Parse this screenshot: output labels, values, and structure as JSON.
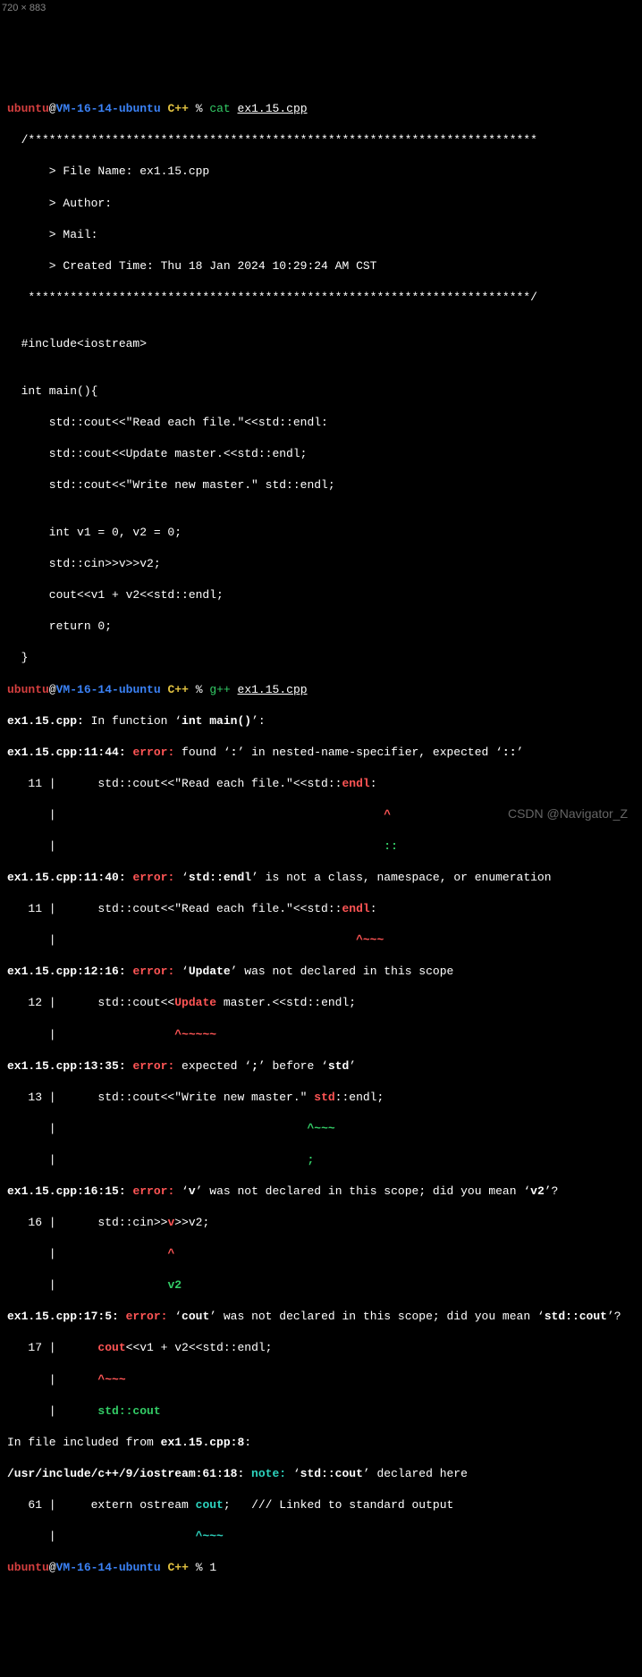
{
  "dim_label": "720 × 883",
  "watermark": "CSDN @Navigator_Z",
  "prompt1": {
    "user": "ubuntu",
    "at": "@",
    "host": "VM-16-14-ubuntu",
    "dir": "C++",
    "pct": "%",
    "cmd": "cat",
    "arg": "ex1.15.cpp"
  },
  "comment_top": "  /*************************************************************************",
  "c_file": "      > File Name: ex1.15.cpp",
  "c_author": "      > Author: ",
  "c_mail": "      > Mail: ",
  "c_time": "      > Created Time: Thu 18 Jan 2024 10:29:24 AM CST",
  "comment_bot": "   ************************************************************************/",
  "blank": "",
  "inc": "  #include<iostream>",
  "main": "  int main(){",
  "s1": "      std::cout<<\"Read each file.\"<<std::endl:",
  "s2": "      std::cout<<Update master.<<std::endl;",
  "s3": "      std::cout<<\"Write new master.\" std::endl;",
  "s4": "      int v1 = 0, v2 = 0;",
  "s5": "      std::cin>>v>>v2;",
  "s6": "      cout<<v1 + v2<<std::endl;",
  "s7": "      return 0;",
  "s8": "  }",
  "prompt2_cmd": "g++",
  "prompt2_arg": "ex1.15.cpp",
  "e_func_hdr": {
    "pre": "ex1.15.cpp:",
    "rest": " In function ‘",
    "fn": "int main()",
    "end": "’:"
  },
  "e1": {
    "loc": "ex1.15.cpp:11:44: ",
    "kind": "error: ",
    "msg1": "found ‘",
    "tok": ":",
    "msg2": "’ in nested-name-specifier, expected ‘",
    "exp": "::",
    "msg3": "’",
    "ln": "   11 |",
    "code_pre": "      std::cout<<\"Read each file.\"<<std::",
    "code_hl": "endl",
    "code_post": ":",
    "bar": "      |",
    "caret": "                                               ",
    "caret_sym": "^",
    "fix_pre": "                                               ",
    "fix": "::"
  },
  "e2": {
    "loc": "ex1.15.cpp:11:40: ",
    "kind": "error: ",
    "msg1": "‘",
    "tok": "std::endl",
    "msg2": "’ is not a class, namespace, or enumeration",
    "ln": "   11 |",
    "code_pre": "      std::cout<<\"Read each file.\"<<std::",
    "code_hl": "endl",
    "code_post": ":",
    "bar": "      |",
    "caret": "                                           ",
    "caret_sym": "^~~~"
  },
  "e3": {
    "loc": "ex1.15.cpp:12:16: ",
    "kind": "error: ",
    "msg1": "‘",
    "tok": "Update",
    "msg2": "’ was not declared in this scope",
    "ln": "   12 |",
    "code_pre": "      std::cout<<",
    "code_hl": "Update",
    "code_post": " master.<<std::endl;",
    "bar": "      |",
    "caret": "                 ",
    "caret_sym": "^~~~~~"
  },
  "e4": {
    "loc": "ex1.15.cpp:13:35: ",
    "kind": "error: ",
    "msg1": "expected ‘",
    "tok": ";",
    "msg2": "’ before ‘",
    "tok2": "std",
    "msg3": "’",
    "ln": "   13 |",
    "code_pre": "      std::cout<<\"Write new master.\" ",
    "code_hl": "std",
    "code_post": "::endl;",
    "bar": "      |",
    "caret": "                                    ",
    "caret_sym": "^~~~",
    "fix_pre": "                                    ",
    "fix": ";"
  },
  "e5": {
    "loc": "ex1.15.cpp:16:15: ",
    "kind": "error: ",
    "msg1": "‘",
    "tok": "v",
    "msg2": "’ was not declared in this scope; did you mean ‘",
    "sugg": "v2",
    "msg3": "’?",
    "ln": "   16 |",
    "code_pre": "      std::cin>>",
    "code_hl": "v",
    "code_post": ">>v2;",
    "bar": "      |",
    "caret": "                ",
    "caret_sym": "^",
    "fix_pre": "                ",
    "fix": "v2"
  },
  "e6": {
    "loc": "ex1.15.cpp:17:5: ",
    "kind": "error: ",
    "msg1": "‘",
    "tok": "cout",
    "msg2": "’ was not declared in this scope; did you mean ‘",
    "sugg": "std::cout",
    "msg3": "’?",
    "ln": "   17 |",
    "code_pre": "      ",
    "code_hl": "cout",
    "code_post": "<<v1 + v2<<std::endl;",
    "bar": "      |",
    "caret": "      ",
    "caret_sym": "^~~~",
    "fix_pre": "      ",
    "fix": "std::cout"
  },
  "inc_from": "In file included from ",
  "inc_from_loc": "ex1.15.cpp:8",
  "inc_from_end": ":",
  "note": {
    "loc": "/usr/include/c++/9/iostream:61:18: ",
    "kind": "note: ",
    "msg1": "‘",
    "tok": "std::cout",
    "msg2": "’ declared here",
    "ln": "   61 |",
    "code_pre": "     extern ostream ",
    "code_hl": "cout",
    "code_post": ";   /// Linked to standard output",
    "bar": "      |",
    "caret": "                    ",
    "caret_sym": "^~~~"
  },
  "prompt3_cmd": "1"
}
